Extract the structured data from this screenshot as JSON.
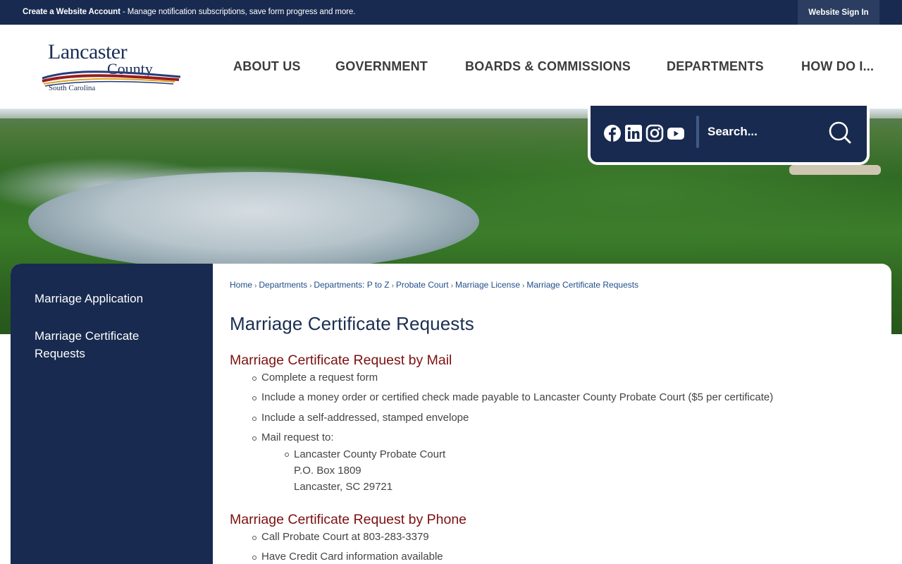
{
  "topbar": {
    "create_bold": "Create a Website Account",
    "create_rest": " - Manage notification subscriptions, save form progress and more.",
    "signin": "Website Sign In"
  },
  "logo": {
    "line1": "Lancaster",
    "line2": "County",
    "line3": "South Carolina",
    "colors": {
      "navy": "#1c2e56",
      "red": "#9b1b1b",
      "gold": "#d9a520",
      "blue": "#243c7a"
    }
  },
  "nav": [
    "ABOUT US",
    "GOVERNMENT",
    "BOARDS & COMMISSIONS",
    "DEPARTMENTS",
    "HOW DO I..."
  ],
  "social": [
    "facebook-icon",
    "linkedin-icon",
    "instagram-icon",
    "youtube-icon"
  ],
  "search": {
    "placeholder": "Search...",
    "icon": "search-icon"
  },
  "sidebar": {
    "items": [
      {
        "label": "Marriage Application"
      },
      {
        "label": "Marriage Certificate Requests"
      }
    ]
  },
  "breadcrumbs": [
    "Home",
    "Departments",
    "Departments: P to Z",
    "Probate Court",
    "Marriage License",
    "Marriage Certificate Requests"
  ],
  "content": {
    "title": "Marriage Certificate Requests",
    "mail": {
      "heading": "Marriage Certificate Request by Mail",
      "items": [
        "Complete a request form",
        "Include a money order or certified check made payable to Lancaster County Probate Court ($5 per certificate)",
        "Include a self-addressed, stamped envelope",
        "Mail request to:"
      ],
      "address": [
        "Lancaster County Probate Court",
        "P.O. Box 1809",
        "Lancaster, SC 29721"
      ]
    },
    "phone": {
      "heading": "Marriage Certificate Request by Phone",
      "items": [
        "Call Probate Court at 803-283-3379",
        "Have Credit Card information available"
      ]
    }
  },
  "colors": {
    "navy": "#182a4f",
    "heading_red": "#7c1010",
    "link": "#1f4e8a"
  }
}
